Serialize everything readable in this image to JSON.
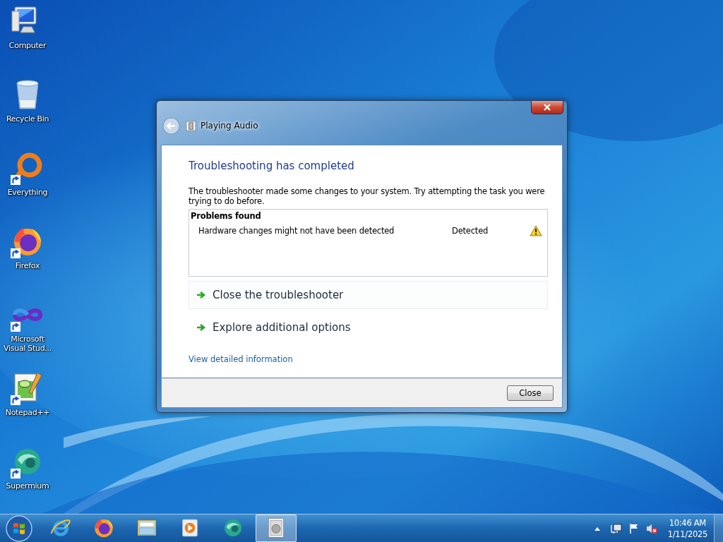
{
  "desktop_icons": [
    {
      "kind": "computer",
      "label": "Computer",
      "shortcut": false
    },
    {
      "kind": "recycle-bin",
      "label": "Recycle Bin",
      "shortcut": false
    },
    {
      "kind": "ring",
      "label": "Everything",
      "shortcut": true
    },
    {
      "kind": "firefox",
      "label": "Firefox",
      "shortcut": true
    },
    {
      "kind": "infinity",
      "label": "Microsoft Visual Stud...",
      "shortcut": true
    },
    {
      "kind": "notepad",
      "label": "Notepad++",
      "shortcut": true
    },
    {
      "kind": "supermium",
      "label": "Supermium",
      "shortcut": true
    }
  ],
  "window": {
    "title": "Playing Audio",
    "heading": "Troubleshooting has completed",
    "message": "The troubleshooter made some changes to your system. Try attempting the task you were trying to do before.",
    "problems": {
      "header": "Problems found",
      "rows": [
        {
          "problem": "Hardware changes might not have been detected",
          "status": "Detected",
          "kind": "warning"
        }
      ]
    },
    "options": [
      {
        "label": "Close the troubleshooter",
        "selected": true
      },
      {
        "label": "Explore additional options",
        "selected": false
      }
    ],
    "link": "View detailed information",
    "buttons": [
      "Close"
    ]
  },
  "taskbar": {
    "apps": [
      {
        "kind": "ie",
        "active": false
      },
      {
        "kind": "firefox",
        "active": false
      },
      {
        "kind": "folder",
        "active": false
      },
      {
        "kind": "media",
        "active": false
      },
      {
        "kind": "supermium",
        "active": false
      },
      {
        "kind": "troubleshooter",
        "active": true
      }
    ],
    "clock": {
      "time": "10:46 AM",
      "date": "1/11/2025"
    }
  }
}
